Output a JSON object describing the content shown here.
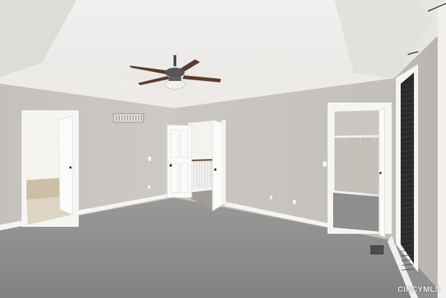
{
  "photo": {
    "watermark_text": "CINCYMLS",
    "colors": {
      "ceiling": "#efeeec",
      "wall": "#c9c6c0",
      "carpet": "#8e8d8c",
      "trim": "#f7f7f5",
      "window_frame": "#1f1f1f"
    }
  }
}
